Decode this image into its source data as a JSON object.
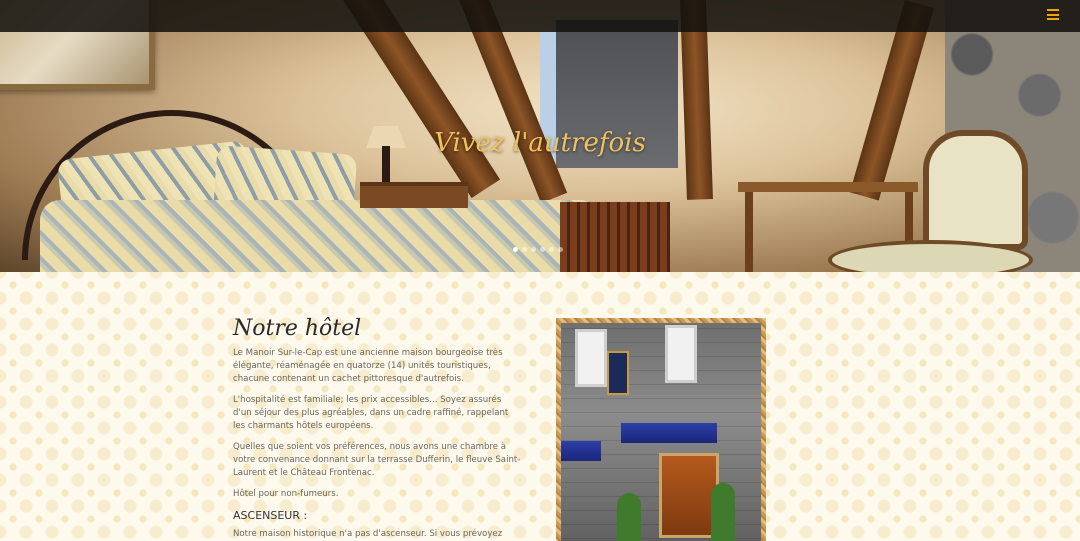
{
  "hero": {
    "title": "Vivez l'autrefois",
    "slider_dots": [
      true,
      false,
      false,
      false,
      false,
      false
    ]
  },
  "nav": {
    "menu_icon": "hamburger-menu-icon",
    "accent_color": "#f1a500"
  },
  "main": {
    "section_title": "Notre hôtel",
    "paragraphs": [
      "Le Manoir Sur-le-Cap est une ancienne maison bourgeoise très élégante, réaménagée en quatorze (14) unités touristiques, chacune contenant un cachet pittoresque d'autrefois.",
      "L'hospitalité est familiale; les prix accessibles... Soyez assurés d'un séjour des plus agréables, dans un cadre raffiné, rappelant les charmants hôtels européens.",
      "Quelles que soient vos préférences, nous avons une chambre à votre convenance donnant sur la terrasse Dufferin, le fleuve Saint-Laurent et le Château Frontenac.",
      "Hôtel pour non-fumeurs."
    ],
    "subheading": "ASCENSEUR :",
    "elevator_text": "Notre maison historique n'a pas d'ascenseur. Si vous prévoyez avoir besoin"
  }
}
